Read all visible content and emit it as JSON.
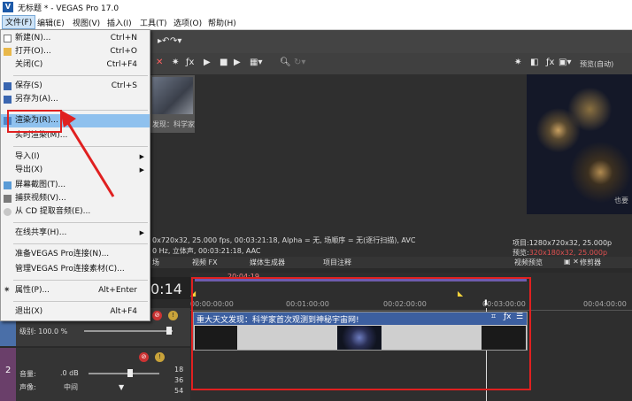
{
  "app": {
    "title": "无标题 * - VEGAS Pro 17.0",
    "logo": "V"
  },
  "menubar": {
    "items": [
      "文件(F)",
      "编辑(E)",
      "视图(V)",
      "插入(I)",
      "工具(T)",
      "选项(O)",
      "帮助(H)"
    ]
  },
  "file_menu": {
    "items": [
      {
        "label": "新建(N)...",
        "shortcut": "Ctrl+N"
      },
      {
        "label": "打开(O)...",
        "shortcut": "Ctrl+O"
      },
      {
        "label": "关闭(C)",
        "shortcut": "Ctrl+F4"
      },
      {
        "label": "保存(S)",
        "shortcut": "Ctrl+S"
      },
      {
        "label": "另存为(A)...",
        "shortcut": ""
      },
      {
        "label": "渲染为(R)...",
        "shortcut": ""
      },
      {
        "label": "实时渲染(M)...",
        "shortcut": ""
      },
      {
        "label": "导入(I)",
        "shortcut": ""
      },
      {
        "label": "导出(X)",
        "shortcut": ""
      },
      {
        "label": "屏幕截图(T)...",
        "shortcut": ""
      },
      {
        "label": "捕获视频(V)...",
        "shortcut": ""
      },
      {
        "label": "从 CD 提取音频(E)...",
        "shortcut": ""
      },
      {
        "label": "在线共享(H)...",
        "shortcut": ""
      },
      {
        "label": "准备VEGAS Pro连接(N)...",
        "shortcut": ""
      },
      {
        "label": "管理VEGAS Pro连接素材(C)...",
        "shortcut": ""
      },
      {
        "label": "属性(P)...",
        "shortcut": "Alt+Enter"
      },
      {
        "label": "退出(X)",
        "shortcut": "Alt+F4"
      }
    ]
  },
  "media": {
    "thumb_caption": "发现：科学家",
    "info_line1": "0x720x32, 25.000 fps, 00:03:21:18, Alpha = 无, 场顺序 = 无(逐行扫描), AVC",
    "info_line2": "0 Hz, 立体声, 00:03:21:18, AAC",
    "tabs": [
      "场",
      "视频 FX",
      "媒体生成器",
      "项目注释"
    ]
  },
  "preview": {
    "mode_label": "预览(自动)",
    "watermark": "也要",
    "project_label": "项目:",
    "project_value": "1280x720x32, 25.000p",
    "preview_label": "预览:",
    "preview_value": "320x180x32, 25.000p",
    "tabs": [
      "视频预览",
      "修剪器"
    ]
  },
  "timeline": {
    "time_display": "0:14",
    "region_label": "20:04:19",
    "ruler": [
      "00:00:00:00",
      "00:01:00:00",
      "00:02:00:00",
      "00:03:00:00",
      "00:04:00:00"
    ],
    "track1_level": "级别: 100.0 %",
    "track2_number": "2",
    "volume_label": "音量:",
    "volume_value": ".0 dB",
    "pan_label": "声像:",
    "pan_value": "中间",
    "audio_scale": [
      "18",
      "36",
      "54"
    ],
    "clip_title": "重大天文发现：科学家首次观测到神秘宇宙网!"
  },
  "colors": {
    "highlight": "#8fc1ee",
    "annotation": "#e02020",
    "clip_header": "#3c5fa0"
  }
}
